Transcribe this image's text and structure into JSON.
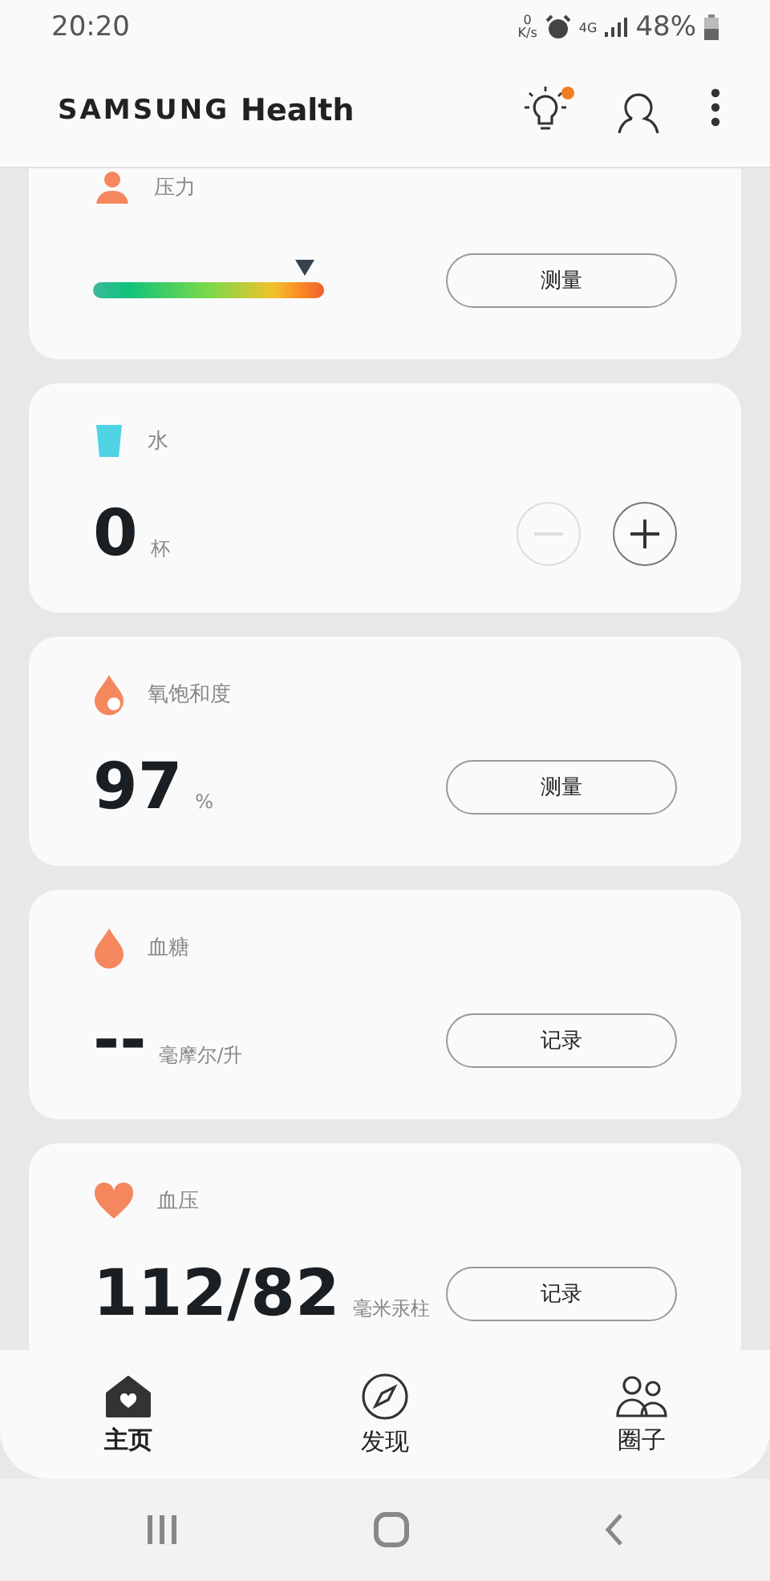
{
  "status_bar": {
    "time": "20:20",
    "net_speed_value": "0",
    "net_speed_unit": "K/s",
    "network": "4G",
    "battery": "48%"
  },
  "header": {
    "brand": "SAMSUNG",
    "product": "Health",
    "has_notification": true
  },
  "cards": [
    {
      "kind": "gauge",
      "title": "压力",
      "button": "测量"
    },
    {
      "kind": "counter",
      "title": "水",
      "value": "0",
      "unit": "杯",
      "minus_disabled": true
    },
    {
      "kind": "reading",
      "title": "氧饱和度",
      "value": "97",
      "unit": "%",
      "button": "测量"
    },
    {
      "kind": "reading",
      "title": "血糖",
      "value": "--",
      "unit": "毫摩尔/升",
      "button": "记录"
    },
    {
      "kind": "reading",
      "title": "血压",
      "value": "112/82",
      "unit": "毫米汞柱",
      "button": "记录"
    }
  ],
  "bottom_nav": [
    {
      "label": "主页",
      "selected": true
    },
    {
      "label": "发现",
      "selected": false
    },
    {
      "label": "圈子",
      "selected": false
    }
  ]
}
